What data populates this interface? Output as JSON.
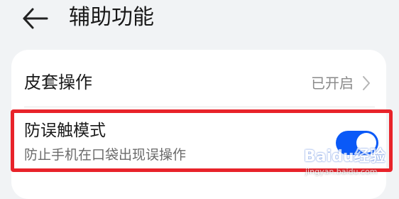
{
  "header": {
    "title": "辅助功能",
    "back_icon": "arrow-left-icon"
  },
  "settings": {
    "cover_operation": {
      "label": "皮套操作",
      "status": "已开启",
      "icon": "chevron-right-icon"
    },
    "accidental_touch_mode": {
      "label": "防误触模式",
      "description": "防止手机在口袋出现误操作",
      "toggle_on": true
    }
  },
  "watermark": {
    "logo": "Baidu经验",
    "url": "jingyan.baidu.com"
  },
  "colors": {
    "background": "#f1f3f5",
    "card": "#ffffff",
    "toggle_on": "#0a59f7",
    "highlight_border": "#e8232a",
    "secondary_text": "#8a8a8a"
  }
}
